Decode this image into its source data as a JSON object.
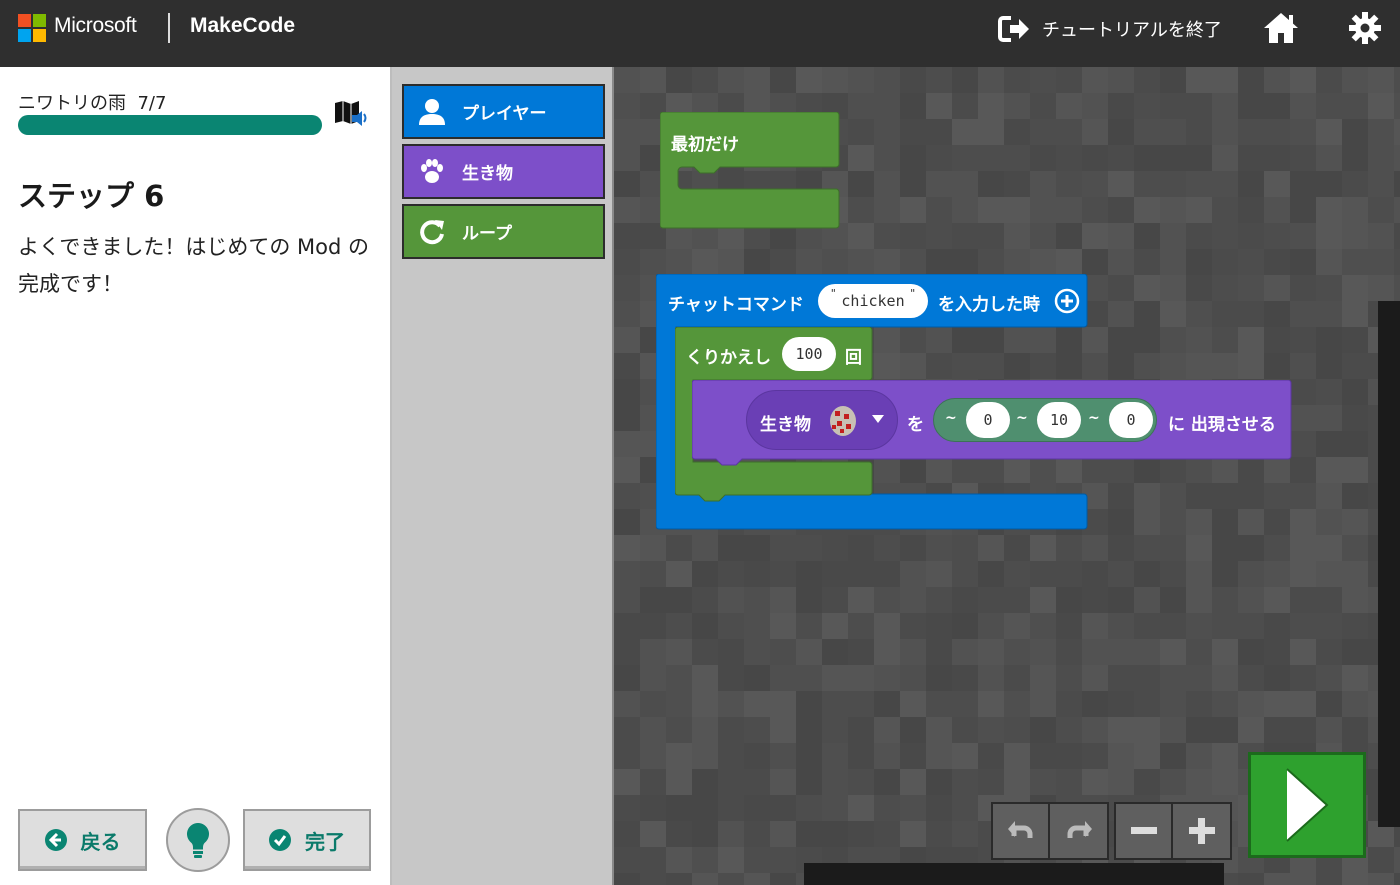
{
  "header": {
    "brand_microsoft": "Microsoft",
    "brand_makecode": "MakeCode",
    "exit_tutorial_label": "チュートリアルを終了"
  },
  "tutorial": {
    "title": "ニワトリの雨",
    "step_counter": "7/7",
    "progress_fraction": 1.0,
    "step_title": "ステップ 6",
    "step_text": "よくできました！はじめての Mod の完成です！",
    "back_label": "戻る",
    "done_label": "完了"
  },
  "toolbox": {
    "categories": [
      {
        "label": "プレイヤー",
        "color": "#0078d7"
      },
      {
        "label": "生き物",
        "color": "#7d4fc9"
      },
      {
        "label": "ループ",
        "color": "#55963a"
      }
    ]
  },
  "workspace": {
    "on_start_label": "最初だけ",
    "chat_command_label": "チャットコマンド",
    "chat_command_value": "chicken",
    "chat_command_suffix": "を入力した時",
    "repeat_label": "くりかえし",
    "repeat_count": "100",
    "repeat_suffix": "回",
    "mob_label": "生き物",
    "object_particle": "を",
    "pos_x": "0",
    "pos_y": "10",
    "pos_z": "0",
    "tilde": "~",
    "spawn_suffix": "に 出現させる"
  },
  "colors": {
    "player_blue": "#0078d7",
    "mobs_purple": "#7d4fc9",
    "loops_green": "#55963a",
    "teal": "#0a8572",
    "run_green": "#2ea12e"
  }
}
